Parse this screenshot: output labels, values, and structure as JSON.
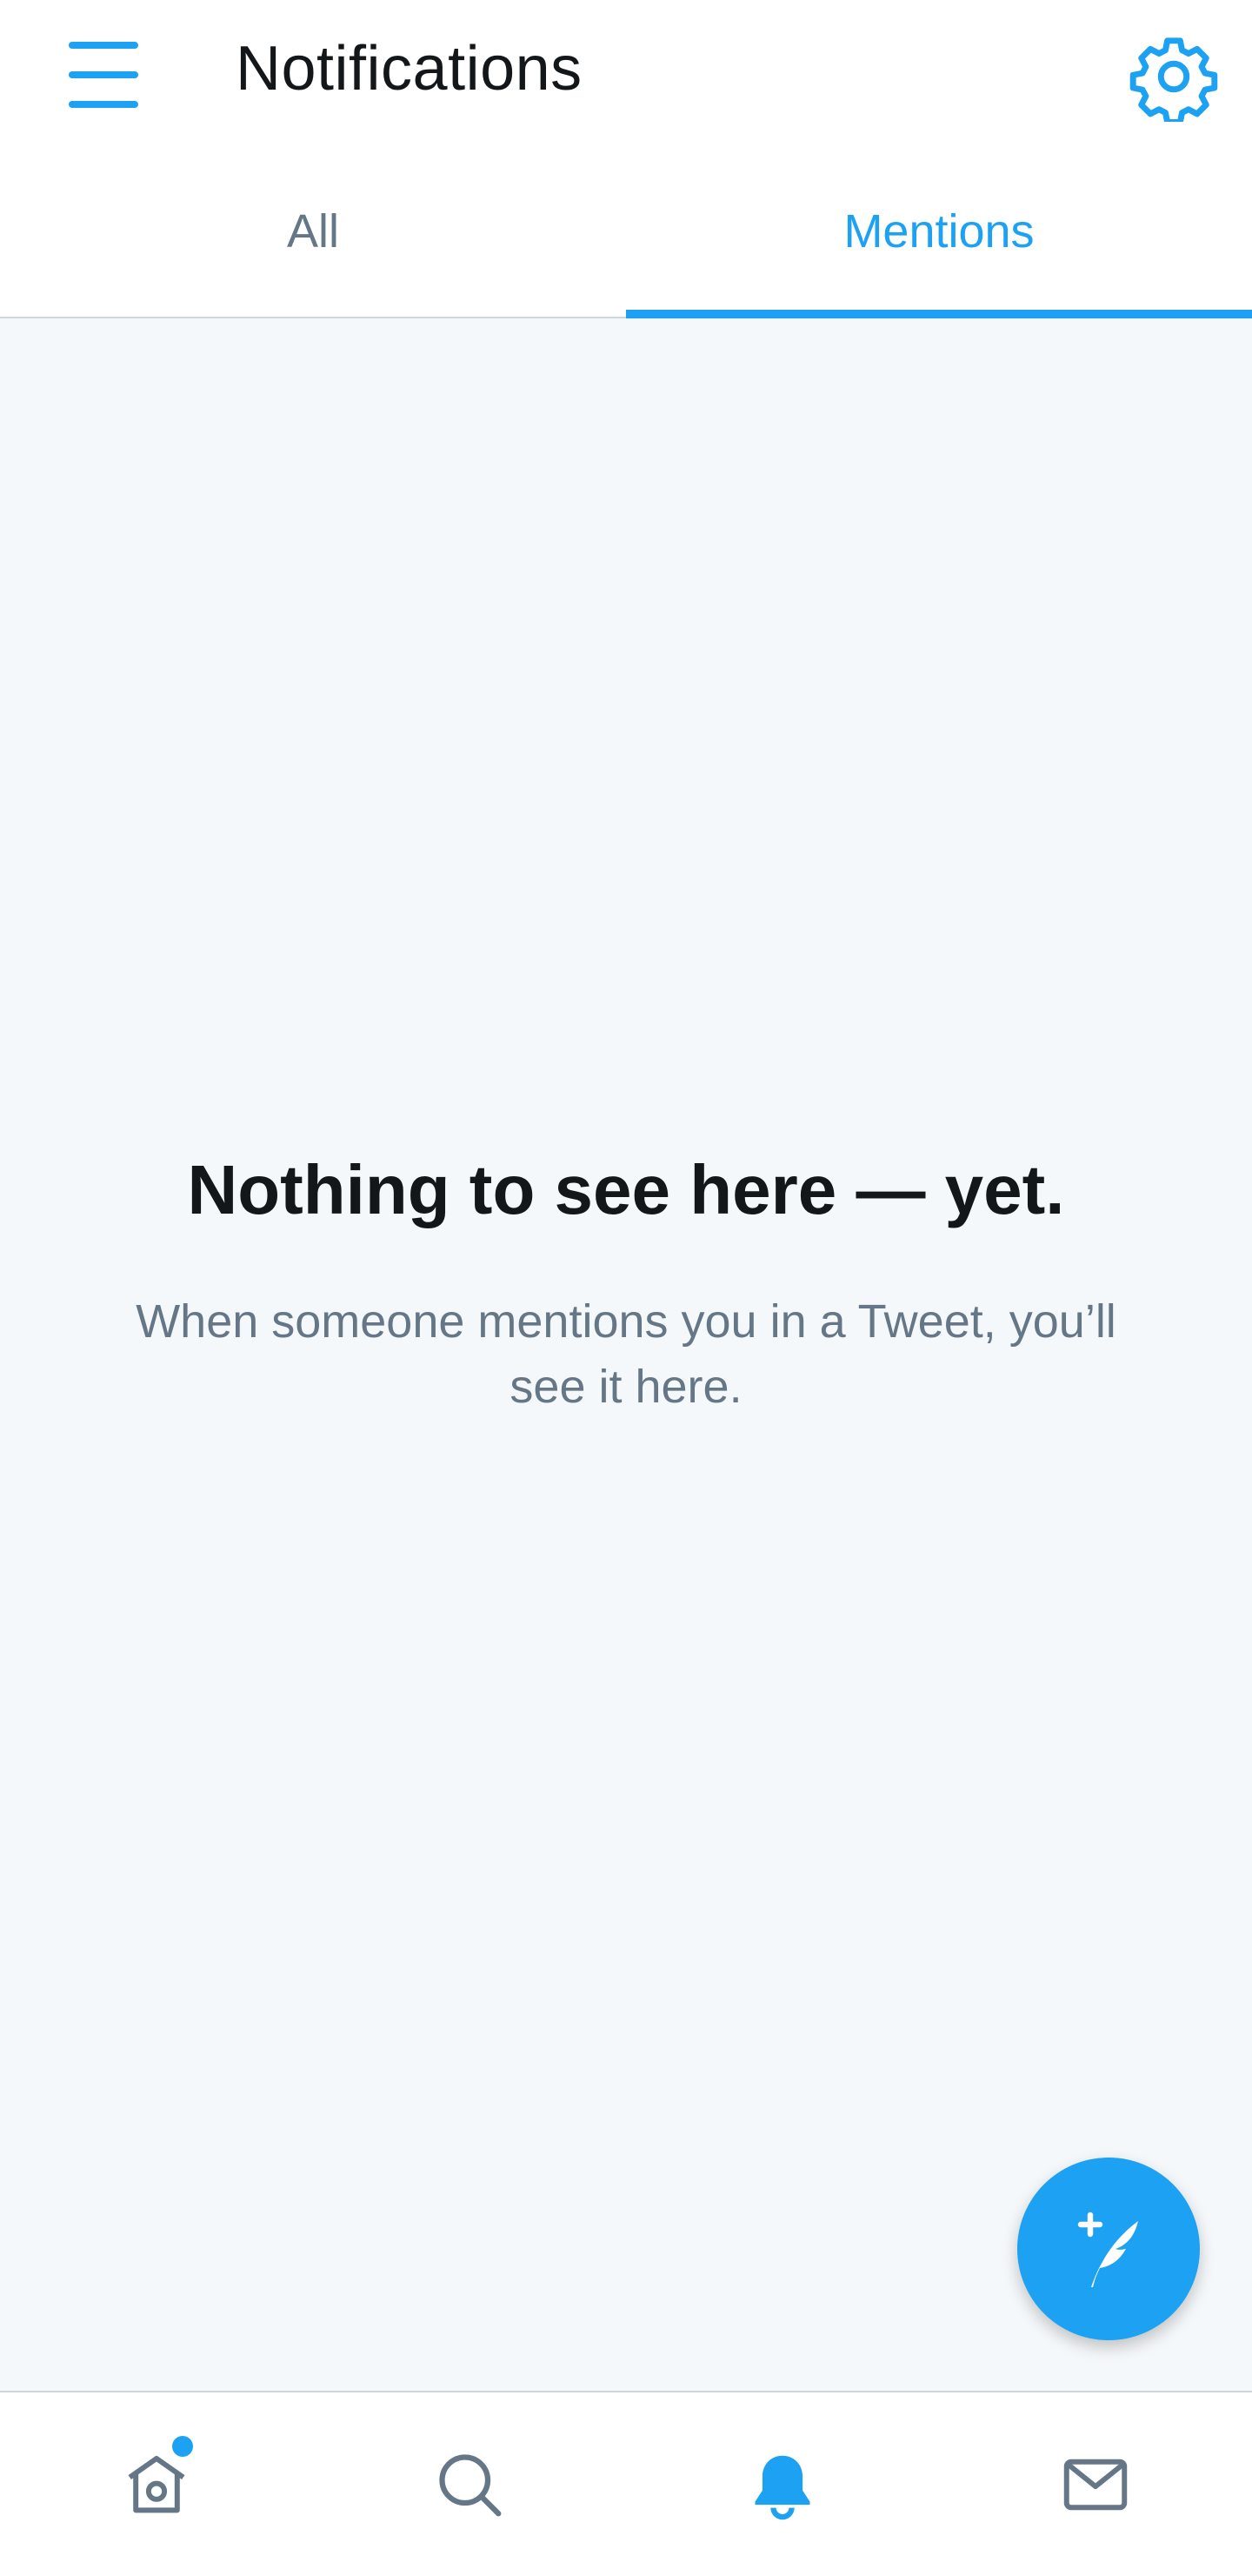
{
  "header": {
    "title": "Notifications",
    "menu_icon": "hamburger-menu-icon",
    "settings_icon": "gear-icon"
  },
  "tabs": [
    {
      "label": "All",
      "active": false
    },
    {
      "label": "Mentions",
      "active": true
    }
  ],
  "empty_state": {
    "title": "Nothing to see here — yet.",
    "body": "When someone mentions you in a Tweet, you’ll see it here."
  },
  "fab": {
    "icon": "compose-tweet-icon"
  },
  "bottom_nav": [
    {
      "icon": "home-icon",
      "active": false,
      "has_new_indicator": true
    },
    {
      "icon": "search-icon",
      "active": false
    },
    {
      "icon": "bell-icon",
      "active": true
    },
    {
      "icon": "mail-icon",
      "active": false
    }
  ],
  "colors": {
    "accent": "#1da1f2",
    "text_primary": "#14171a",
    "text_secondary": "#657786",
    "background": "#f5f8fa"
  }
}
